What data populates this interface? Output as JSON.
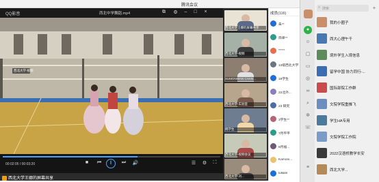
{
  "window": {
    "title": "腾讯会议"
  },
  "player": {
    "app_name": "QQ影音",
    "file_name": "西北中学舞蹈.mp4",
    "time": "00:02:05 / 00:03:20",
    "progress_fraction": 0.62,
    "share_label": "西北大学王娜的屏幕共享"
  },
  "video_overlay": {
    "label": "西北大学-视频"
  },
  "cameras": [
    {
      "name": "西北大学王娜的屏幕共享"
    },
    {
      "name": "西北大学-视频"
    },
    {
      "name": "SUMONWAN CHAN..."
    },
    {
      "name": "西北大学-实验室"
    },
    {
      "name": "韩学生"
    },
    {
      "name": "西北大学-视频会议"
    },
    {
      "name": "西北大学-刘..."
    }
  ],
  "members": {
    "header": "成员(116)",
    "items": [
      {
        "name": "朱**"
      },
      {
        "name": "简单**"
      },
      {
        "name": "*****"
      },
      {
        "name": "13级西北大学"
      },
      {
        "name": "18学生"
      },
      {
        "name": "22北外..."
      },
      {
        "name": "23 研究"
      },
      {
        "name": "3学生**"
      },
      {
        "name": "7月平平"
      },
      {
        "name": "8月福..."
      },
      {
        "name": "Kamoni..."
      },
      {
        "name": "lullalin"
      }
    ]
  },
  "chat": {
    "search_placeholder": "搜索",
    "items": [
      {
        "name": "我的小圈子"
      },
      {
        "name": "西大心理午千"
      },
      {
        "name": "境外学生入境信息"
      },
      {
        "name": "留学中国 协力同行-..."
      },
      {
        "name": "国际部院工作群"
      },
      {
        "name": "文院学院重推飞"
      },
      {
        "name": "学生HA专用"
      },
      {
        "name": "文院学院工作院"
      },
      {
        "name": "2022汉语桥教学长安"
      },
      {
        "name": "西北大学..."
      }
    ]
  }
}
